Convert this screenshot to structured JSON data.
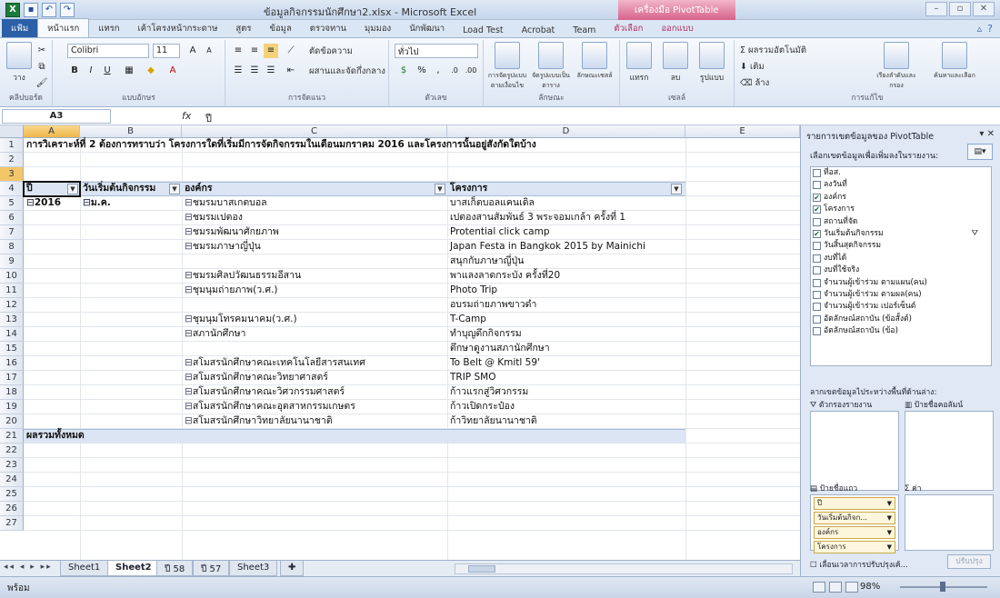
{
  "window": {
    "title": "ข้อมูลกิจกรรมนักศึกษา2.xlsx - Microsoft Excel",
    "tool_title": "เครื่องมือ PivotTable"
  },
  "ribbon_tabs": [
    "แฟ้ม",
    "หน้าแรก",
    "แทรก",
    "เค้าโครงหน้ากระดาษ",
    "สูตร",
    "ข้อมูล",
    "ตรวจทาน",
    "มุมมอง",
    "นักพัฒนา",
    "Load Test",
    "Acrobat",
    "Team",
    "ตัวเลือก",
    "ออกแบบ"
  ],
  "ribbon": {
    "paste": "วาง",
    "clipboard": "คลิปบอร์ด",
    "font_name": "Colibri",
    "font_size": "11",
    "font_group": "แบบอักษร",
    "wrap_text": "ตัดข้อความ",
    "merge_center": "ผสานและจัดกึ่งกลาง",
    "alignment_group": "การจัดแนว",
    "number_format": "ทั่วไป",
    "number_group": "ตัวเลข",
    "cond_format": "การจัดรูปแบบตามเงื่อนไข",
    "format_table": "จัดรูปแบบเป็นตาราง",
    "cell_styles": "ลักษณะเซลล์",
    "styles_group": "ลักษณะ",
    "insert": "แทรก",
    "delete": "ลบ",
    "format": "รูปแบบ",
    "cells_group": "เซลล์",
    "autosum": "ผลรวมอัตโนมัติ",
    "fill": "เติม",
    "clear": "ล้าง",
    "sort_filter": "เรียงลำดับและกรอง",
    "find_select": "ค้นหาและเลือก",
    "editing_group": "การแก้ไข"
  },
  "formula_bar": {
    "name_box": "A3",
    "fx": "fx",
    "value": "ปี"
  },
  "columns": [
    "A",
    "B",
    "C",
    "D",
    "E"
  ],
  "row_numbers": [
    "1",
    "2",
    "3",
    "4",
    "5",
    "6",
    "7",
    "8",
    "9",
    "10",
    "11",
    "12",
    "13",
    "14",
    "15",
    "16",
    "17",
    "18",
    "19",
    "20",
    "21",
    "22",
    "23",
    "24",
    "25",
    "26",
    "27"
  ],
  "sheet": {
    "title": "การวิเคราะห์ที่ 2 ต้องการทราบว่า   โครงการใดที่เริ่มมีการจัดกิจกรรมในเดือนมกราคม   2016 และโครงการนั้นอยู่สังกัดใดบ้าง",
    "headers": {
      "a": "ปี",
      "b": "วันเริ่มต้นกิจกรรม",
      "c": "องค์กร",
      "d": "โครงการ"
    },
    "year": "2016",
    "month": "ม.ค.",
    "rows": [
      {
        "org": "ชมรมบาสเกตบอล",
        "project": "บาสเก็ตบอลแคนเดิล"
      },
      {
        "org": "ชมรมเปตอง",
        "project": "เปตองสานสัมพันธ์  3 พระจอมเกล้า   ครั้งที่  1"
      },
      {
        "org": "ชมรมพัฒนาศักยภาพ",
        "project": "Protential click camp"
      },
      {
        "org": "ชมรมภาษาญี่ปุ่น",
        "project": "Japan Festa in Bangkok 2015 by Mainichi"
      },
      {
        "org": "",
        "project": "สนุกกับภาษาญี่ปุ่น"
      },
      {
        "org": "ชมรมศิลปวัฒนธรรมอีสาน",
        "project": "พาแลงลาดกระบัง  ครั้งที่20"
      },
      {
        "org": "ชุมนุมถ่ายภาพ(ว.ศ.)",
        "project": "Photo Trip"
      },
      {
        "org": "",
        "project": "อบรมถ่ายภาพขาวดำ"
      },
      {
        "org": "ชุมนุมโทรคมนาคม(ว.ศ.)",
        "project": "T-Camp"
      },
      {
        "org": "สภานักศึกษา",
        "project": "ทำบุญตึกกิจกรรม"
      },
      {
        "org": "",
        "project": "ตึกษาดูงานสภานักศึกษา"
      },
      {
        "org": "สโมสรนักศึกษาคณะเทคโนโลยีสารสนเทศ",
        "project": "To Belt @ Kmitl 59'"
      },
      {
        "org": "สโมสรนักศึกษาคณะวิทยาศาสตร์",
        "project": "TRIP SMO"
      },
      {
        "org": "สโมสรนักศึกษาคณะวิศวกรรมศาสตร์",
        "project": "ก้าวแรกสู่วิศวกรรม"
      },
      {
        "org": "สโมสรนักศึกษาคณะอุตสาหกรรมเกษตร",
        "project": "ก้าวเปิดกระป๋อง"
      },
      {
        "org": "สโมสรนักศึกษาวิทยาลัยนานาชาติ",
        "project": "ก้าวิทยาลัยนานาชาติ"
      }
    ],
    "grand_total": "ผลรวมทั้งหมด"
  },
  "sheet_tabs": [
    "Sheet1",
    "Sheet2",
    "ปี 58",
    "ปี 57",
    "Sheet3"
  ],
  "status": {
    "ready": "พร้อม",
    "zoom": "98%"
  },
  "pivot_pane": {
    "title": "รายการเขตข้อมูลของ PivotTable",
    "choose_fields": "เลือกเขตข้อมูลเพื่อเพิ่มลงในรายงาน:",
    "fields": [
      {
        "label": "ที่อส.",
        "checked": false
      },
      {
        "label": "ลงวันที่",
        "checked": false
      },
      {
        "label": "องค์กร",
        "checked": true
      },
      {
        "label": "โครงการ",
        "checked": true
      },
      {
        "label": "สถานที่จัด",
        "checked": false
      },
      {
        "label": "วันเริ่มต้นกิจกรรม",
        "checked": true
      },
      {
        "label": "วันสิ้นสุดกิจกรรม",
        "checked": false
      },
      {
        "label": "งบที่ได้",
        "checked": false
      },
      {
        "label": "งบที่ใช้จริง",
        "checked": false
      },
      {
        "label": "จำนวนผู้เข้าร่วม ตามแผน(คน)",
        "checked": false
      },
      {
        "label": "จำนวนผู้เข้าร่วม ตามผล(คน)",
        "checked": false
      },
      {
        "label": "จำนวนผู้เข้าร่วม เปอร์เซ็นต์",
        "checked": false
      },
      {
        "label": "อัตลักษณ์สถาบัน (ข้อสั้งต์)",
        "checked": false
      },
      {
        "label": "อัตลักษณ์สถาบัน (ข้อ)",
        "checked": false
      }
    ],
    "drag_between": "ลากเขตข้อมูลไประหว่างพื้นที่ด้านล่าง:",
    "report_filter": "ตัวกรองรายงาน",
    "column_labels": "ป้ายชื่อคอลัมน์",
    "row_labels": "ป้ายชื่อแถว",
    "values": "ค่า",
    "row_fields": [
      "ปี",
      "วันเริ่มต้นกิจก...",
      "องค์กร",
      "โครงการ"
    ],
    "defer_update": "เลื่อนเวลาการปรับปรุงเค้...",
    "update": "ปรับปรุง"
  }
}
